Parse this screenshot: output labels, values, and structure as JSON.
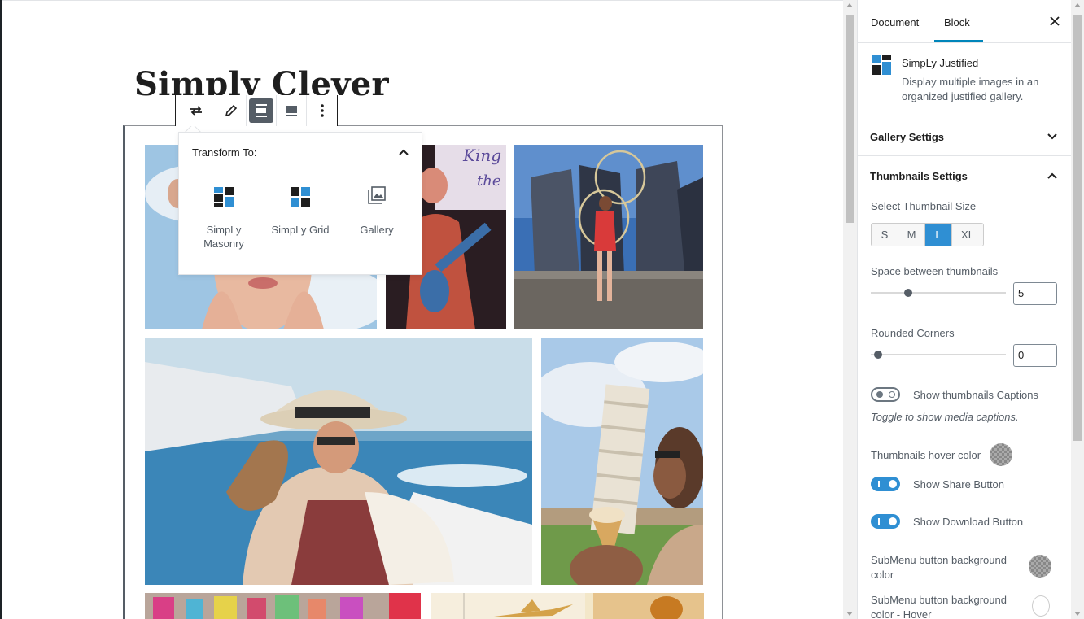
{
  "post": {
    "title": "Simply Clever"
  },
  "toolbar": {
    "buttons": [
      "transform-icon",
      "pencil-icon",
      "align-wide-icon",
      "align-full-icon",
      "more-vertical-icon"
    ],
    "active": "align-wide-icon"
  },
  "transform_popover": {
    "heading": "Transform To:",
    "items": [
      {
        "label": "SimpLy Masonry",
        "icon": "masonry-icon"
      },
      {
        "label": "SimpLy Grid",
        "icon": "grid-icon"
      },
      {
        "label": "Gallery",
        "icon": "gallery-icon"
      }
    ]
  },
  "gallery": {
    "images": [
      "woman-face-clouds",
      "guitarist-stage",
      "hula-hoop-dancer",
      "woman-on-boat",
      "leaning-tower-ice-cream",
      "market-colors",
      "airplane-sunset",
      "drink-glass"
    ]
  },
  "sidebar": {
    "tabs": [
      "Document",
      "Block"
    ],
    "active_tab": "Block",
    "block": {
      "name": "SimpLy Justified",
      "description": "Display multiple images in an organized justified gallery."
    },
    "panels": {
      "gallery": "Gallery Settigs",
      "thumbnails": "Thumbnails Settigs"
    },
    "thumb_size": {
      "label": "Select Thumbnail Size",
      "options": [
        "S",
        "M",
        "L",
        "XL"
      ],
      "selected": "L"
    },
    "space": {
      "label": "Space between thumbnails",
      "value": "5",
      "fraction": 0.25
    },
    "corners": {
      "label": "Rounded Corners",
      "value": "0",
      "fraction": 0.0
    },
    "captions": {
      "label": "Show thumbnails Captions",
      "help": "Toggle to show media captions.",
      "on": false
    },
    "hover_color": {
      "label": "Thumbnails hover color"
    },
    "share": {
      "label": "Show Share Button",
      "on": true
    },
    "download": {
      "label": "Show Download Button",
      "on": true
    },
    "submenu_bg": {
      "label": "SubMenu button background color"
    },
    "submenu_bg_hover": {
      "label": "SubMenu button background color - Hover"
    }
  },
  "colors": {
    "accent": "#2f8fd3",
    "tab_underline": "#0085ba",
    "block_icon_dark": "#1e1e1e",
    "block_icon_blue": "#2f8fd3"
  }
}
